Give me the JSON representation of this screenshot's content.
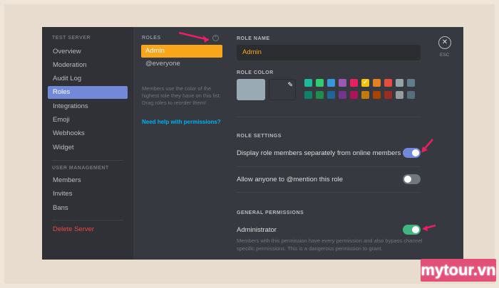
{
  "sidebar": {
    "server_section": "TEST SERVER",
    "items": [
      "Overview",
      "Moderation",
      "Audit Log",
      "Roles",
      "Integrations",
      "Emoji",
      "Webhooks",
      "Widget"
    ],
    "user_section": "USER MANAGEMENT",
    "user_items": [
      "Members",
      "Invites",
      "Bans"
    ],
    "delete": "Delete Server",
    "active_item": "Roles"
  },
  "roles": {
    "header": "ROLES",
    "list": [
      "Admin",
      "@everyone"
    ],
    "hint": "Members use the color of the highest role they have on this list. Drag roles to reorder them!",
    "help_link": "Need help with permissions?"
  },
  "main": {
    "role_name_label": "ROLE NAME",
    "role_name_value": "Admin",
    "role_color_label": "ROLE COLOR",
    "role_settings_label": "ROLE SETTINGS",
    "settings": [
      {
        "label": "Display role members separately from online members",
        "on": true
      },
      {
        "label": "Allow anyone to @mention this role",
        "on": false
      }
    ],
    "general_permissions_label": "GENERAL PERMISSIONS",
    "administrator_label": "Administrator",
    "administrator_on": true,
    "administrator_desc": "Members with this permission have every permission and also bypass channel specific permissions. This is a dangerous permission to grant."
  },
  "close": {
    "icon": "close-icon",
    "label": "ESC"
  },
  "colors": {
    "swatches_row1": [
      "#1abc9c",
      "#2ecc71",
      "#3498db",
      "#9b59b6",
      "#e91e63",
      "#f1c40f",
      "#e67e22",
      "#e74c3c",
      "#95a5a6",
      "#607d8b"
    ],
    "swatches_row2": [
      "#11806a",
      "#1f8b4c",
      "#206694",
      "#71368a",
      "#ad1457",
      "#c27c0e",
      "#a84300",
      "#992d22",
      "#979c9f",
      "#546e7a"
    ],
    "selected_swatch": "#f1c40f",
    "toggle_on_display": "#7289da",
    "toggle_on_admin": "#43b581",
    "toggle_off": "#72767d",
    "arrow": "#e91e63"
  },
  "watermark": "mytour.vn"
}
